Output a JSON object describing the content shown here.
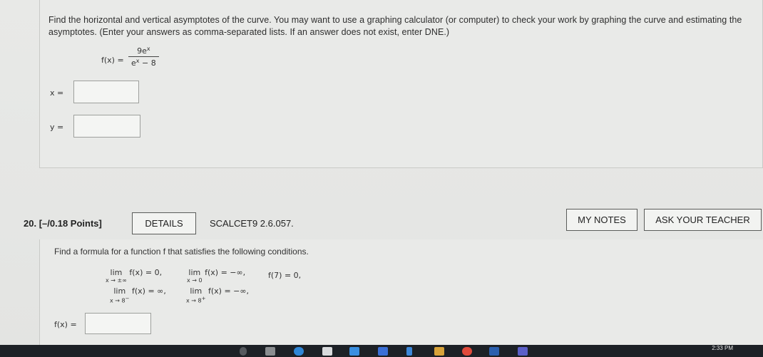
{
  "q19": {
    "instructions": "Find the horizontal and vertical asymptotes of the curve. You may want to use a graphing calculator (or computer) to check your work by graphing the curve and estimating the asymptotes. (Enter your answers as comma-separated lists. If an answer does not exist, enter DNE.)",
    "function_label": "f(x) =",
    "numerator_coef": "9e",
    "numerator_exp": "x",
    "denominator_base": "e",
    "denominator_exp": "x",
    "denominator_rest": " − 8",
    "x_label": "x =",
    "y_label": "y =",
    "x_value": "",
    "y_value": ""
  },
  "q20": {
    "number": "20.",
    "points": "[–/0.18 Points]",
    "details_label": "DETAILS",
    "code": "SCALCET9 2.6.057.",
    "my_notes_label": "MY NOTES",
    "ask_teacher_label": "ASK YOUR TEACHER",
    "instructions": "Find a formula for a function f that satisfies the following conditions.",
    "conditions": {
      "c1_lim": "lim",
      "c1_sub": "x → ±∞",
      "c1_expr": "f(x) = 0,",
      "c2_lim": "lim",
      "c2_sub": "x → 0",
      "c2_expr": "f(x) = −∞,",
      "c3_expr": "f(7) = 0,",
      "c4_lim": "lim",
      "c4_sub": "x → 8",
      "c4_sup": "−",
      "c4_expr": "f(x) = ∞,",
      "c5_lim": "lim",
      "c5_sub": "x → 8",
      "c5_sup": "+",
      "c5_expr": "f(x) = −∞,"
    },
    "answer_label": "f(x) =",
    "answer_value": ""
  },
  "taskbar": {
    "time": "2:33 PM",
    "icons": [
      "search-icon",
      "task-view-icon",
      "edge-icon",
      "store-icon",
      "mail-icon",
      "dropbox-icon",
      "arrow-icon",
      "photos-icon",
      "chrome-icon",
      "word-icon",
      "teams-icon"
    ]
  }
}
